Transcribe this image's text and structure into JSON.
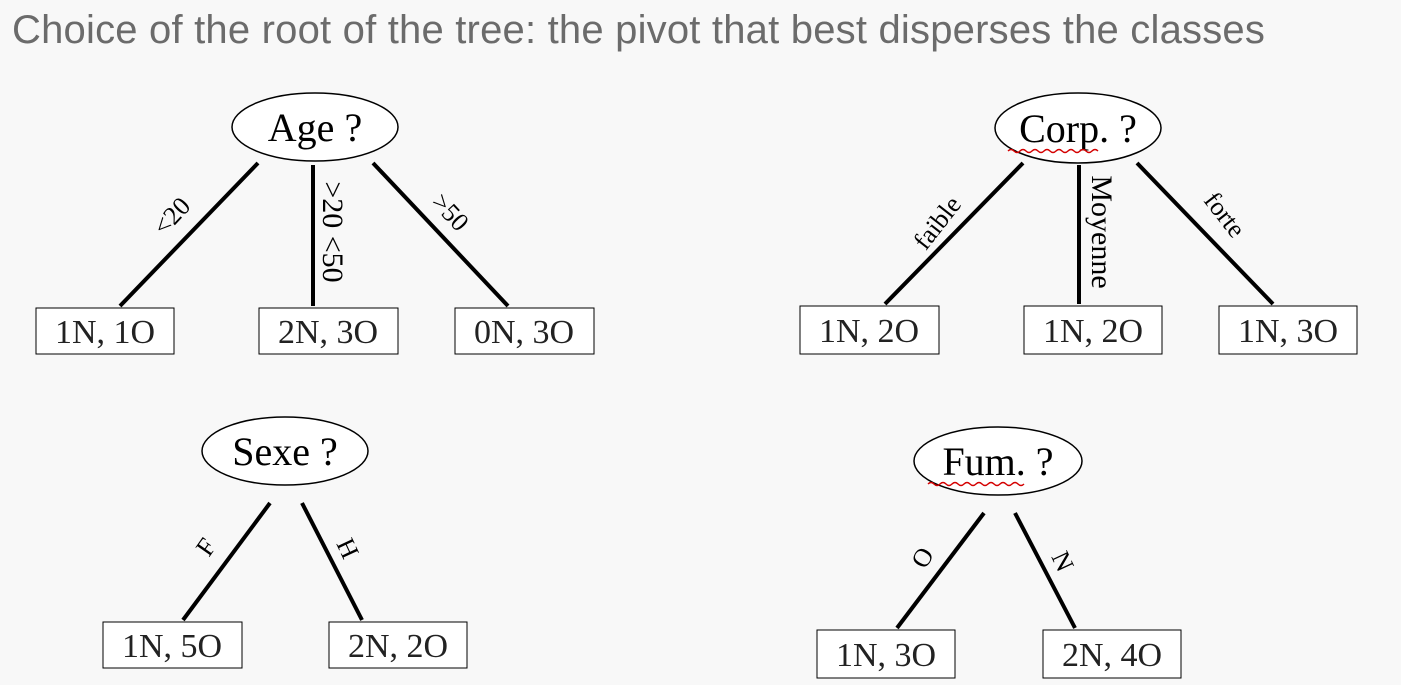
{
  "title": "Choice of the root of the tree: the pivot that best disperses the classes",
  "trees": {
    "age": {
      "root": "Age ?",
      "edges": [
        "<20",
        ">20 <50",
        ">50"
      ],
      "leaves": [
        "1N, 1O",
        "2N, 3O",
        "0N, 3O"
      ]
    },
    "corp": {
      "root": "Corp. ?",
      "edges": [
        "faible",
        "Moyenne",
        "forte"
      ],
      "leaves": [
        "1N, 2O",
        "1N, 2O",
        "1N, 3O"
      ]
    },
    "sexe": {
      "root": "Sexe ?",
      "edges": [
        "F",
        "H"
      ],
      "leaves": [
        "1N, 5O",
        "2N, 2O"
      ]
    },
    "fum": {
      "root": "Fum. ?",
      "edges": [
        "O",
        "N"
      ],
      "leaves": [
        "1N, 3O",
        "2N, 4O"
      ]
    }
  }
}
